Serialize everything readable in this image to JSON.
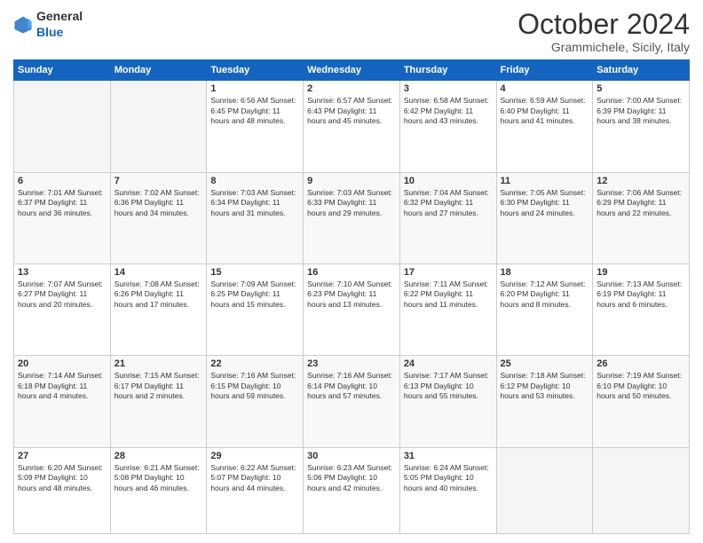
{
  "header": {
    "logo_general": "General",
    "logo_blue": "Blue",
    "month_title": "October 2024",
    "location": "Grammichele, Sicily, Italy"
  },
  "weekdays": [
    "Sunday",
    "Monday",
    "Tuesday",
    "Wednesday",
    "Thursday",
    "Friday",
    "Saturday"
  ],
  "weeks": [
    [
      {
        "day": "",
        "info": ""
      },
      {
        "day": "",
        "info": ""
      },
      {
        "day": "1",
        "info": "Sunrise: 6:56 AM\nSunset: 6:45 PM\nDaylight: 11 hours and 48 minutes."
      },
      {
        "day": "2",
        "info": "Sunrise: 6:57 AM\nSunset: 6:43 PM\nDaylight: 11 hours and 45 minutes."
      },
      {
        "day": "3",
        "info": "Sunrise: 6:58 AM\nSunset: 6:42 PM\nDaylight: 11 hours and 43 minutes."
      },
      {
        "day": "4",
        "info": "Sunrise: 6:59 AM\nSunset: 6:40 PM\nDaylight: 11 hours and 41 minutes."
      },
      {
        "day": "5",
        "info": "Sunrise: 7:00 AM\nSunset: 6:39 PM\nDaylight: 11 hours and 38 minutes."
      }
    ],
    [
      {
        "day": "6",
        "info": "Sunrise: 7:01 AM\nSunset: 6:37 PM\nDaylight: 11 hours and 36 minutes."
      },
      {
        "day": "7",
        "info": "Sunrise: 7:02 AM\nSunset: 6:36 PM\nDaylight: 11 hours and 34 minutes."
      },
      {
        "day": "8",
        "info": "Sunrise: 7:03 AM\nSunset: 6:34 PM\nDaylight: 11 hours and 31 minutes."
      },
      {
        "day": "9",
        "info": "Sunrise: 7:03 AM\nSunset: 6:33 PM\nDaylight: 11 hours and 29 minutes."
      },
      {
        "day": "10",
        "info": "Sunrise: 7:04 AM\nSunset: 6:32 PM\nDaylight: 11 hours and 27 minutes."
      },
      {
        "day": "11",
        "info": "Sunrise: 7:05 AM\nSunset: 6:30 PM\nDaylight: 11 hours and 24 minutes."
      },
      {
        "day": "12",
        "info": "Sunrise: 7:06 AM\nSunset: 6:29 PM\nDaylight: 11 hours and 22 minutes."
      }
    ],
    [
      {
        "day": "13",
        "info": "Sunrise: 7:07 AM\nSunset: 6:27 PM\nDaylight: 11 hours and 20 minutes."
      },
      {
        "day": "14",
        "info": "Sunrise: 7:08 AM\nSunset: 6:26 PM\nDaylight: 11 hours and 17 minutes."
      },
      {
        "day": "15",
        "info": "Sunrise: 7:09 AM\nSunset: 6:25 PM\nDaylight: 11 hours and 15 minutes."
      },
      {
        "day": "16",
        "info": "Sunrise: 7:10 AM\nSunset: 6:23 PM\nDaylight: 11 hours and 13 minutes."
      },
      {
        "day": "17",
        "info": "Sunrise: 7:11 AM\nSunset: 6:22 PM\nDaylight: 11 hours and 11 minutes."
      },
      {
        "day": "18",
        "info": "Sunrise: 7:12 AM\nSunset: 6:20 PM\nDaylight: 11 hours and 8 minutes."
      },
      {
        "day": "19",
        "info": "Sunrise: 7:13 AM\nSunset: 6:19 PM\nDaylight: 11 hours and 6 minutes."
      }
    ],
    [
      {
        "day": "20",
        "info": "Sunrise: 7:14 AM\nSunset: 6:18 PM\nDaylight: 11 hours and 4 minutes."
      },
      {
        "day": "21",
        "info": "Sunrise: 7:15 AM\nSunset: 6:17 PM\nDaylight: 11 hours and 2 minutes."
      },
      {
        "day": "22",
        "info": "Sunrise: 7:16 AM\nSunset: 6:15 PM\nDaylight: 10 hours and 59 minutes."
      },
      {
        "day": "23",
        "info": "Sunrise: 7:16 AM\nSunset: 6:14 PM\nDaylight: 10 hours and 57 minutes."
      },
      {
        "day": "24",
        "info": "Sunrise: 7:17 AM\nSunset: 6:13 PM\nDaylight: 10 hours and 55 minutes."
      },
      {
        "day": "25",
        "info": "Sunrise: 7:18 AM\nSunset: 6:12 PM\nDaylight: 10 hours and 53 minutes."
      },
      {
        "day": "26",
        "info": "Sunrise: 7:19 AM\nSunset: 6:10 PM\nDaylight: 10 hours and 50 minutes."
      }
    ],
    [
      {
        "day": "27",
        "info": "Sunrise: 6:20 AM\nSunset: 5:09 PM\nDaylight: 10 hours and 48 minutes."
      },
      {
        "day": "28",
        "info": "Sunrise: 6:21 AM\nSunset: 5:08 PM\nDaylight: 10 hours and 46 minutes."
      },
      {
        "day": "29",
        "info": "Sunrise: 6:22 AM\nSunset: 5:07 PM\nDaylight: 10 hours and 44 minutes."
      },
      {
        "day": "30",
        "info": "Sunrise: 6:23 AM\nSunset: 5:06 PM\nDaylight: 10 hours and 42 minutes."
      },
      {
        "day": "31",
        "info": "Sunrise: 6:24 AM\nSunset: 5:05 PM\nDaylight: 10 hours and 40 minutes."
      },
      {
        "day": "",
        "info": ""
      },
      {
        "day": "",
        "info": ""
      }
    ]
  ]
}
